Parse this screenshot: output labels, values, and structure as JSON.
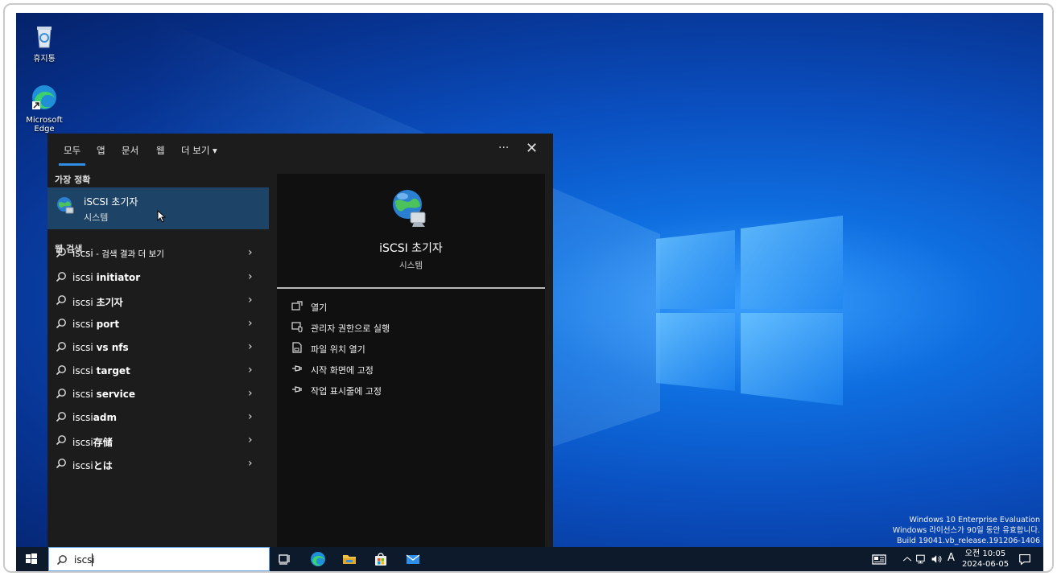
{
  "desktop": {
    "icons": [
      {
        "label": "휴지통"
      },
      {
        "label": "Microsoft Edge"
      }
    ],
    "watermark": {
      "line1": "Windows 10 Enterprise Evaluation",
      "line2": "Windows 라이선스가 90일 동안 유효합니다.",
      "line3": "Build 19041.vb_release.191206-1406"
    }
  },
  "flyout": {
    "tabs": [
      {
        "label": "모두",
        "active": true
      },
      {
        "label": "앱"
      },
      {
        "label": "문서"
      },
      {
        "label": "웹"
      },
      {
        "label": "더 보기 ▾"
      }
    ],
    "more_label": "···",
    "close_label": "✕",
    "best_match_header": "가장 정확",
    "best_match": {
      "title": "iSCSI 초기자",
      "subtitle": "시스템"
    },
    "web_header": "웹 검색",
    "web_results": [
      {
        "plain": "iscsi",
        "bold": "",
        "suffix": " - 검색 결과 더 보기"
      },
      {
        "plain": "iscsi ",
        "bold": "initiator",
        "suffix": ""
      },
      {
        "plain": "iscsi ",
        "bold": "초기자",
        "suffix": ""
      },
      {
        "plain": "iscsi ",
        "bold": "port",
        "suffix": ""
      },
      {
        "plain": "iscsi ",
        "bold": "vs nfs",
        "suffix": ""
      },
      {
        "plain": "iscsi ",
        "bold": "target",
        "suffix": ""
      },
      {
        "plain": "iscsi ",
        "bold": "service",
        "suffix": ""
      },
      {
        "plain": "iscsi",
        "bold": "adm",
        "suffix": ""
      },
      {
        "plain": "iscsi",
        "bold": "存储",
        "suffix": ""
      },
      {
        "plain": "iscsi",
        "bold": "とは",
        "suffix": ""
      }
    ],
    "chevron": "›",
    "preview": {
      "title": "iSCSI 초기자",
      "subtitle": "시스템",
      "actions": [
        {
          "label": "열기",
          "icon": "open-icon"
        },
        {
          "label": "관리자 권한으로 실행",
          "icon": "run-as-admin-icon"
        },
        {
          "label": "파일 위치 열기",
          "icon": "file-location-icon"
        },
        {
          "label": "시작 화면에 고정",
          "icon": "pin-icon"
        },
        {
          "label": "작업 표시줄에 고정",
          "icon": "pin-icon"
        }
      ]
    }
  },
  "taskbar": {
    "search_value": "iscsi",
    "apps": [
      "task-view-icon",
      "edge-icon",
      "file-explorer-icon",
      "store-icon",
      "mail-icon"
    ],
    "tray": {
      "ime": "A"
    },
    "clock": {
      "time": "오전 10:05",
      "date": "2024-06-05"
    }
  },
  "colors": {
    "accent": "#2f8fe6",
    "selection": "#1d4466",
    "flyout_bg": "#1c1c1c"
  }
}
